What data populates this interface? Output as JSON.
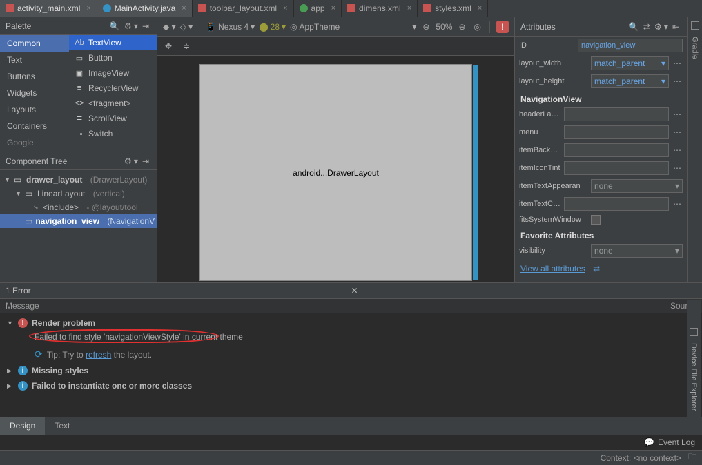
{
  "tabs": [
    {
      "label": "activity_main.xml",
      "type": "xml",
      "active": true
    },
    {
      "label": "MainActivity.java",
      "type": "java",
      "active": true
    },
    {
      "label": "toolbar_layout.xml",
      "type": "xml",
      "active": false
    },
    {
      "label": "app",
      "type": "app",
      "active": false
    },
    {
      "label": "dimens.xml",
      "type": "xml",
      "active": false
    },
    {
      "label": "styles.xml",
      "type": "xml",
      "active": false
    }
  ],
  "palette": {
    "title": "Palette",
    "categories": [
      "Common",
      "Text",
      "Buttons",
      "Widgets",
      "Layouts",
      "Containers",
      "Google"
    ],
    "items": [
      {
        "icon": "Ab",
        "label": "TextView",
        "sel": true
      },
      {
        "icon": "▭",
        "label": "Button"
      },
      {
        "icon": "▣",
        "label": "ImageView"
      },
      {
        "icon": "≡",
        "label": "RecyclerView"
      },
      {
        "icon": "<>",
        "label": "<fragment>"
      },
      {
        "icon": "≣",
        "label": "ScrollView"
      },
      {
        "icon": "⊸",
        "label": "Switch"
      }
    ]
  },
  "componentTree": {
    "title": "Component Tree",
    "rows": [
      {
        "indent": 0,
        "arrow": "▼",
        "icon": "▭",
        "name": "drawer_layout",
        "type": "(DrawerLayout)"
      },
      {
        "indent": 1,
        "arrow": "▼",
        "icon": "▭",
        "name": "LinearLayout",
        "type": "(vertical)"
      },
      {
        "indent": 2,
        "arrow": "↘",
        "icon": "",
        "name": "<include>",
        "type": "- @layout/tool"
      },
      {
        "indent": 1,
        "arrow": "",
        "icon": "▭",
        "name": "navigation_view",
        "type": "(NavigationV",
        "sel": true
      }
    ]
  },
  "toolbar": {
    "device": "Nexus 4",
    "api": "28",
    "theme": "AppTheme",
    "zoom": "50%"
  },
  "preview": {
    "text": "android...DrawerLayout"
  },
  "attributes": {
    "title": "Attributes",
    "id": {
      "label": "ID",
      "value": "navigation_view"
    },
    "layout_width": {
      "label": "layout_width",
      "value": "match_parent"
    },
    "layout_height": {
      "label": "layout_height",
      "value": "match_parent"
    },
    "section1": "NavigationView",
    "headerLayout": {
      "label": "headerLayout",
      "value": ""
    },
    "menu": {
      "label": "menu",
      "value": ""
    },
    "itemBackground": {
      "label": "itemBackground",
      "value": ""
    },
    "itemIconTint": {
      "label": "itemIconTint",
      "value": ""
    },
    "itemTextAppearance": {
      "label": "itemTextAppearan",
      "value": "none"
    },
    "itemTextColor": {
      "label": "itemTextColor",
      "value": ""
    },
    "fitsSystemWindows": {
      "label": "fitsSystemWindow"
    },
    "section2": "Favorite Attributes",
    "visibility": {
      "label": "visibility",
      "value": "none"
    },
    "viewAll": "View all attributes"
  },
  "errors": {
    "count": "1 Error",
    "colMessage": "Message",
    "colSource": "Source",
    "items": [
      {
        "title": "Render problem",
        "severity": "error",
        "open": true,
        "detail": "Failed to find style 'navigationViewStyle' in current theme",
        "tipPrefix": "Tip: Try to ",
        "tipLink": "refresh",
        "tipSuffix": " the layout."
      },
      {
        "title": "Missing styles",
        "severity": "info",
        "open": false
      },
      {
        "title": "Failed to instantiate one or more classes",
        "severity": "info",
        "open": false
      }
    ]
  },
  "bottomTabs": {
    "design": "Design",
    "text": "Text"
  },
  "eventLog": "Event Log",
  "status": {
    "context": "Context: <no context>"
  },
  "sidebarRight": {
    "gradle": "Gradle",
    "dfe": "Device File Explorer"
  }
}
